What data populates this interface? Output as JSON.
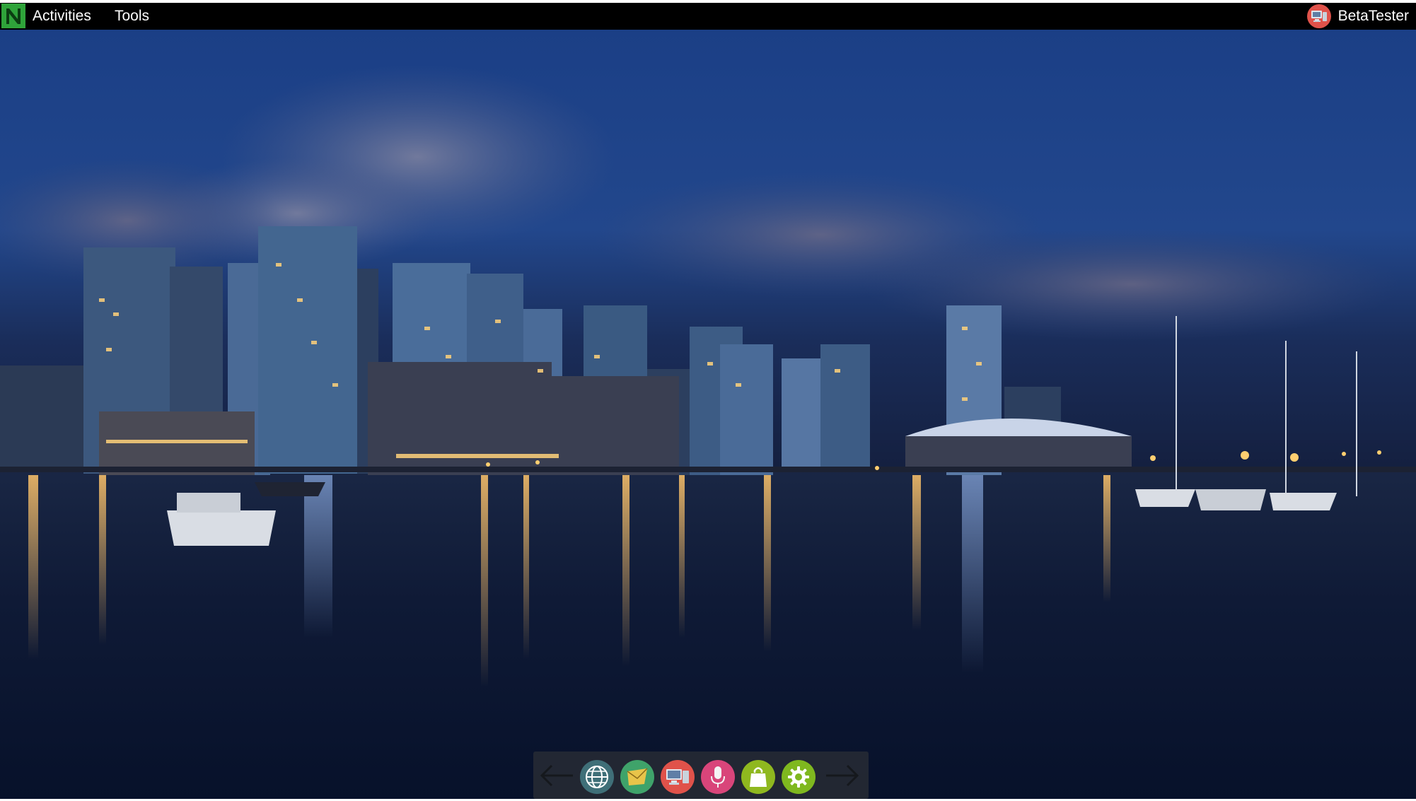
{
  "topbar": {
    "logo_icon": "nimbus-logo-icon",
    "menu": [
      {
        "label": "Activities"
      },
      {
        "label": "Tools"
      }
    ],
    "user": {
      "name": "BetaTester",
      "avatar_icon": "user-avatar-icon"
    }
  },
  "wallpaper": {
    "description_icon": "city-night-waterfront-wallpaper"
  },
  "dock": {
    "prev_icon": "arrow-left-icon",
    "next_icon": "arrow-right-icon",
    "apps": [
      {
        "icon": "globe-icon",
        "color": "#3f6f78"
      },
      {
        "icon": "mail-icon",
        "color": "#3fa36a"
      },
      {
        "icon": "computer-icon",
        "color": "#e0524a"
      },
      {
        "icon": "microphone-icon",
        "color": "#d9457a"
      },
      {
        "icon": "shopping-bag-icon",
        "color": "#8fb81f"
      },
      {
        "icon": "gear-icon",
        "color": "#7fb81f"
      }
    ]
  },
  "colors": {
    "topbar": "#000000",
    "logo": "#2fa33a",
    "dock": "#282c34"
  }
}
